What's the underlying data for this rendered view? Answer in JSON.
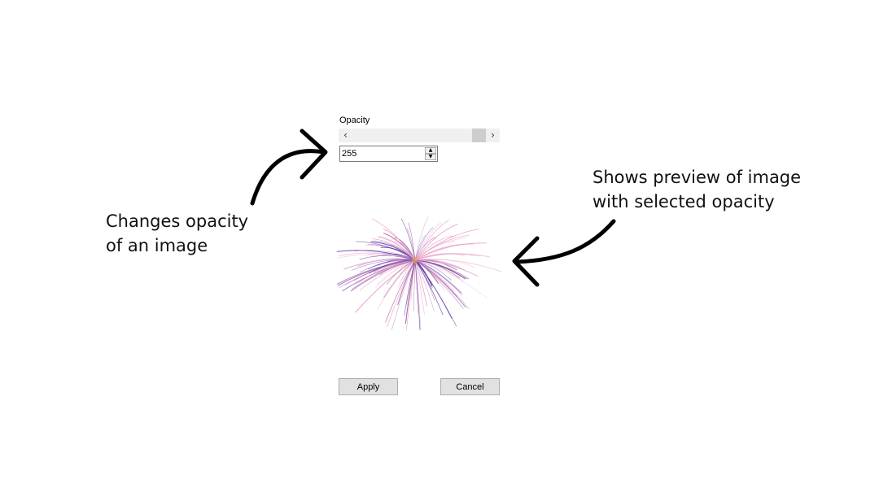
{
  "dialog": {
    "opacity_label": "Opacity",
    "opacity_value": "255",
    "slider_level": 1.0,
    "apply_label": "Apply",
    "cancel_label": "Cancel"
  },
  "icons": {
    "scroll_left": "chevron-left-icon",
    "scroll_right": "chevron-right-icon",
    "spin_up": "caret-up-icon",
    "spin_down": "caret-down-icon"
  },
  "annotations": {
    "left_line1": "Changes opacity",
    "left_line2": "of an image",
    "right_line1": "Shows preview of image",
    "right_line2": "with selected opacity"
  },
  "colors": {
    "firework_purple": "#4a3aa8",
    "firework_pink": "#e8a0c8",
    "firework_magenta": "#b05aa0",
    "firework_orange": "#e8a040"
  }
}
